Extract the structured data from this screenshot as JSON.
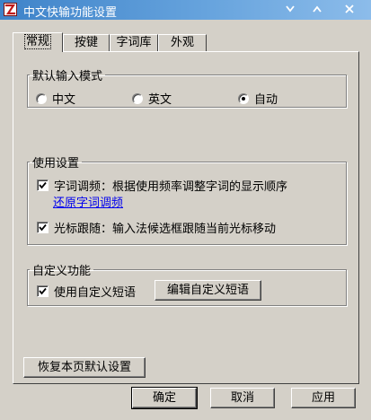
{
  "window": {
    "title": "中文快输功能设置",
    "controls": [
      "minimize-icon",
      "restore-icon",
      "close-icon"
    ]
  },
  "tabs": [
    {
      "label": "常规",
      "active": true
    },
    {
      "label": "按键",
      "active": false
    },
    {
      "label": "字词库",
      "active": false
    },
    {
      "label": "外观",
      "active": false
    }
  ],
  "input_mode": {
    "legend": "默认输入模式",
    "options": [
      {
        "label": "中文",
        "checked": false
      },
      {
        "label": "英文",
        "checked": false
      },
      {
        "label": "自动",
        "checked": true
      }
    ]
  },
  "usage": {
    "legend": "使用设置",
    "freq_adjust": {
      "label": "字词调频：根据使用频率调整字词的显示顺序",
      "checked": true
    },
    "restore_link": "还原字词调频",
    "cursor_follow": {
      "label": "光标跟随：输入法候选框跟随当前光标移动",
      "checked": true
    }
  },
  "custom": {
    "legend": "自定义功能",
    "use_phrase": {
      "label": "使用自定义短语",
      "checked": true
    },
    "edit_button": "编辑自定义短语"
  },
  "restore_defaults_button": "恢复本页默认设置",
  "footer": {
    "ok": "确定",
    "cancel": "取消",
    "apply": "应用"
  }
}
